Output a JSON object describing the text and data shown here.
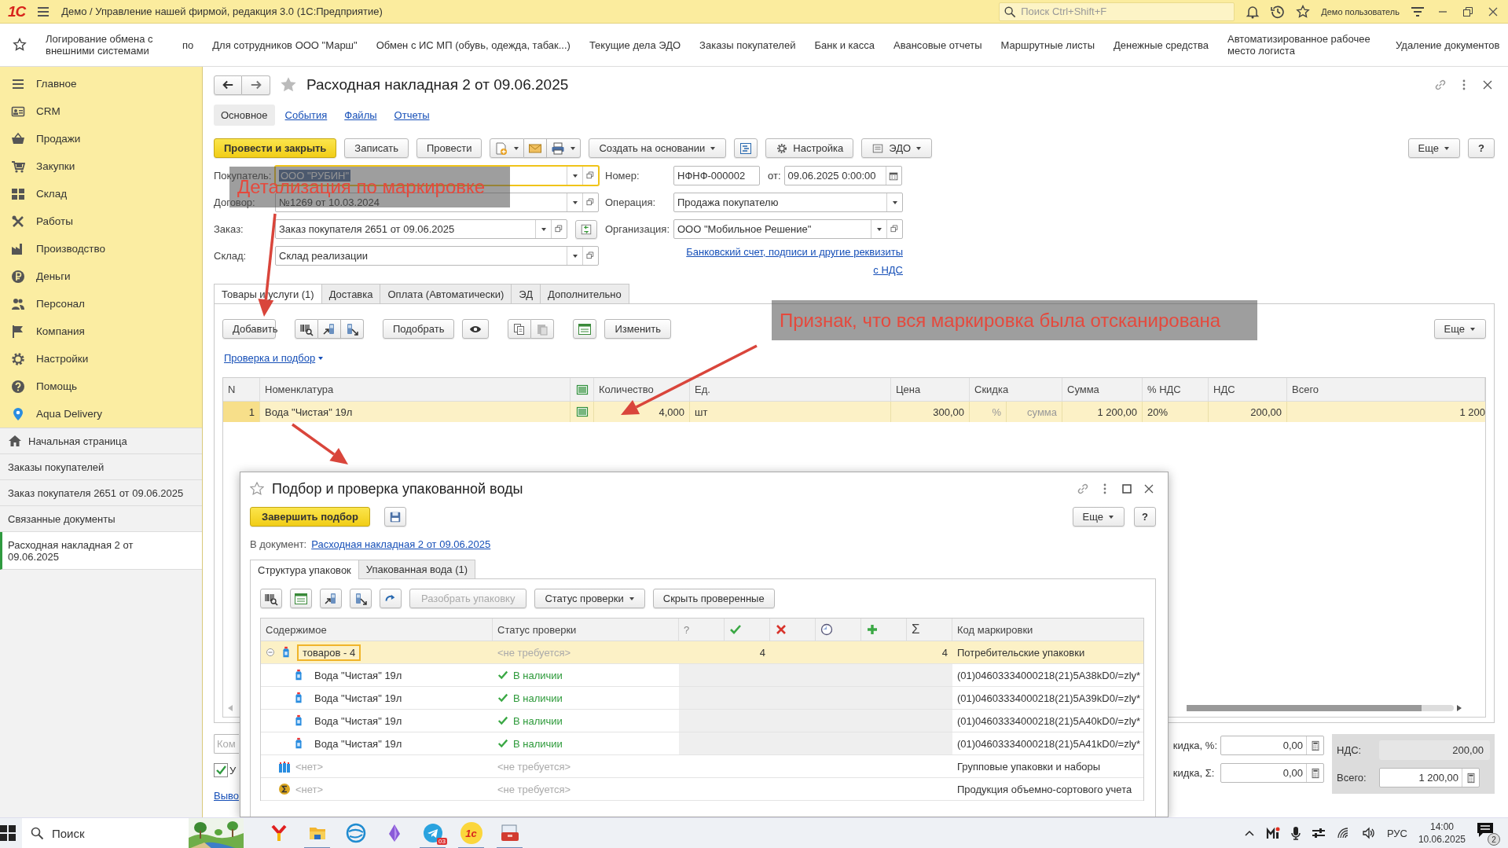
{
  "window": {
    "logo": "1С",
    "title": "Демо / Управление нашей фирмой, редакция 3.0  (1С:Предприятие)",
    "search_placeholder": "Поиск Ctrl+Shift+F",
    "user": "Демо пользователь"
  },
  "favorites": [
    {
      "label": "Логирование обмена с внешними системами",
      "kind": "two-line"
    },
    {
      "label": "по",
      "kind": "one-line"
    },
    {
      "label": "Для сотрудников ООО \"Марш\"",
      "kind": "one-line"
    },
    {
      "label": "Обмен с ИС МП (обувь, одежда, табак...)",
      "kind": "one-line"
    },
    {
      "label": "Текущие дела ЭДО",
      "kind": "one-line"
    },
    {
      "label": "Заказы покупателей",
      "kind": "one-line"
    },
    {
      "label": "Банк и касса",
      "kind": "one-line"
    },
    {
      "label": "Авансовые отчеты",
      "kind": "one-line"
    },
    {
      "label": "Маршрутные листы",
      "kind": "one-line"
    },
    {
      "label": "Денежные средства",
      "kind": "one-line"
    },
    {
      "label": "Автоматизированное рабочее место логиста",
      "kind": "two-line"
    },
    {
      "label": "Удаление документов",
      "kind": "one-line"
    }
  ],
  "sidebar": {
    "sections": [
      "Главное",
      "CRM",
      "Продажи",
      "Закупки",
      "Склад",
      "Работы",
      "Производство",
      "Деньги",
      "Персонал",
      "Компания",
      "Настройки",
      "Помощь",
      "Aqua Delivery"
    ],
    "history": [
      {
        "label": "Начальная страница",
        "kind": "home",
        "selected": false
      },
      {
        "label": "Заказы покупателей",
        "kind": "page",
        "selected": false
      },
      {
        "label": "Заказ покупателя 2651 от 09.06.2025",
        "kind": "page",
        "selected": false
      },
      {
        "label": "Связанные документы",
        "kind": "page",
        "selected": false
      },
      {
        "label": "Расходная накладная 2 от 09.06.2025",
        "kind": "page",
        "selected": true
      }
    ]
  },
  "document": {
    "title": "Расходная накладная 2 от 09.06.2025",
    "tabs": [
      {
        "label": "Основное",
        "selected": true
      },
      {
        "label": "События",
        "selected": false
      },
      {
        "label": "Файлы",
        "selected": false
      },
      {
        "label": "Отчеты",
        "selected": false
      }
    ],
    "toolbar": {
      "post_close": "Провести и закрыть",
      "save": "Записать",
      "post": "Провести",
      "create_based": "Создать на основании",
      "settings": "Настройка",
      "edo": "ЭДО",
      "more": "Еще",
      "help": "?"
    },
    "fields": [
      {
        "label": "Покупатель:",
        "value": "ООО \"РУБИН\"",
        "kind": "ref",
        "focused": true
      },
      {
        "label": "Договор:",
        "value": "№1269 от 10.03.2024",
        "kind": "ref",
        "focused": false
      },
      {
        "label": "Заказ:",
        "value": "Заказ покупателя 2651 от 09.06.2025",
        "kind": "ref-linked",
        "focused": false
      },
      {
        "label": "Склад:",
        "value": "Склад реализации",
        "kind": "ref",
        "focused": false
      }
    ],
    "number": {
      "label": "Номер:",
      "value": "НФНФ-000002",
      "date_label": "от:",
      "date": "09.06.2025  0:00:00"
    },
    "fields_right": [
      {
        "label": "Операция:",
        "value": "Продажа покупателю",
        "kind": "choice",
        "focused": false
      },
      {
        "label": "Организация:",
        "value": "ООО \"Мобильное Решение\"",
        "kind": "ref",
        "focused": false
      }
    ],
    "bank_link": "Банковский счет, подписи и другие реквизиты",
    "vat_link": "с НДС",
    "goods_tabs": [
      {
        "label": "Товары и услуги (1)",
        "selected": true
      },
      {
        "label": "Доставка",
        "selected": false
      },
      {
        "label": "Оплата (Автоматически)",
        "selected": false
      },
      {
        "label": "ЭД",
        "selected": false
      },
      {
        "label": "Дополнительно",
        "selected": false
      }
    ],
    "goods_toolbar": {
      "add": "Добавить",
      "pick": "Подобрать",
      "change": "Изменить",
      "more": "Еще"
    },
    "check_link": "Проверка и подбор",
    "columns": [
      "N",
      "Номенклатура",
      "Количество",
      "Ед.",
      "Цена",
      "Скидка",
      "Сумма",
      "% НДС",
      "НДС",
      "Всего"
    ],
    "rows": [
      {
        "n": "1",
        "name": "Вода \"Чистая\" 19л",
        "qty": "4,000",
        "unit": "шт",
        "price": "300,00",
        "discount_pct": "%",
        "discount_sum": "сумма",
        "sum": "1 200,00",
        "vat_rate": "20%",
        "vat": "200,00",
        "total": "1 200",
        "selected": true
      }
    ],
    "footer": {
      "comment_placeholder": "Ком",
      "checkbox": {
        "label": "У",
        "checked": true
      },
      "link": "Выво",
      "discount_pct": {
        "label": "кидка, %:",
        "value": "0,00"
      },
      "discount_sum": {
        "label": "кидка, Σ:",
        "value": "0,00"
      },
      "vat": {
        "label": "НДС:",
        "value": "200,00"
      },
      "total": {
        "label": "Всего:",
        "value": "1 200,00"
      }
    }
  },
  "dialog": {
    "title": "Подбор и проверка упакованной воды",
    "finish": "Завершить подбор",
    "more": "Еще",
    "help": "?",
    "doc_label": "В документ:",
    "doc_link": "Расходная накладная 2 от 09.06.2025",
    "tabs": [
      {
        "label": "Структура упаковок",
        "selected": true
      },
      {
        "label": "Упакованная вода (1)",
        "selected": false
      }
    ],
    "toolbar": {
      "unpack": "Разобрать упаковку",
      "status": "Статус проверки",
      "hide": "Скрыть проверенные"
    },
    "columns": [
      "Содержимое",
      "Статус проверки",
      "?",
      "Σ",
      "Код маркировки"
    ],
    "rows": [
      {
        "kind": "group",
        "content": "товаров - 4",
        "status": "<не требуется>",
        "ok": "4",
        "total": "4",
        "code": "Потребительские упаковки",
        "expanded": true,
        "selected": true
      },
      {
        "kind": "item",
        "content": "Вода \"Чистая\" 19л",
        "status": "В наличии",
        "code": "(01)04603334000218(21)5A38kD0/=zly*",
        "selected": false
      },
      {
        "kind": "item",
        "content": "Вода \"Чистая\" 19л",
        "status": "В наличии",
        "code": "(01)04603334000218(21)5A39kD0/=zly*",
        "selected": false
      },
      {
        "kind": "item",
        "content": "Вода \"Чистая\" 19л",
        "status": "В наличии",
        "code": "(01)04603334000218(21)5A40kD0/=zly*",
        "selected": false
      },
      {
        "kind": "item",
        "content": "Вода \"Чистая\" 19л",
        "status": "В наличии",
        "code": "(01)04603334000218(21)5A41kD0/=zly*",
        "selected": false
      },
      {
        "kind": "pack",
        "content": "<нет>",
        "status": "<не требуется>",
        "code": "Групповые упаковки и наборы",
        "selected": false
      },
      {
        "kind": "bulk",
        "content": "<нет>",
        "status": "<не требуется>",
        "code": "Продукция объемно-сортового учета",
        "selected": false
      }
    ]
  },
  "annotations": [
    {
      "text": "Детализация по маркировке"
    },
    {
      "text": "Признак, что вся маркировка была отсканирована"
    }
  ],
  "taskbar": {
    "search": "Поиск",
    "app_label": "1с",
    "badge": "03",
    "lang": "РУС",
    "time": "14:00",
    "date": "10.06.2025",
    "notifications": "2"
  }
}
